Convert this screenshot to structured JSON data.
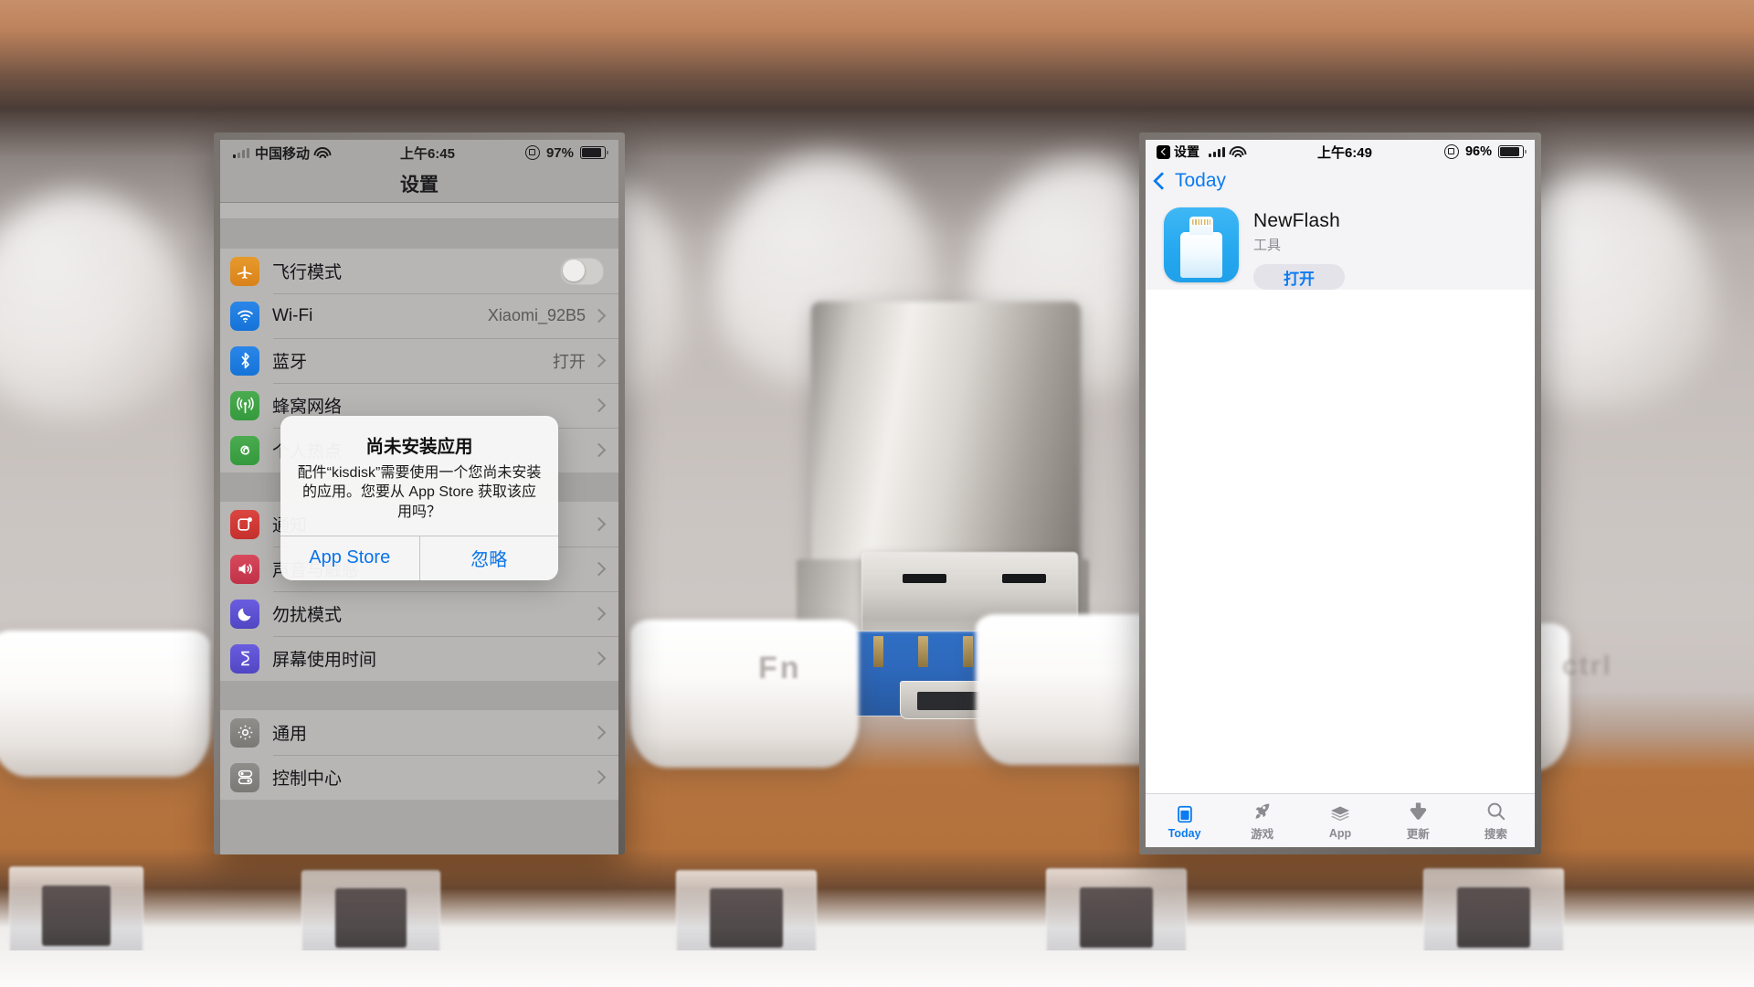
{
  "background": {
    "scene": "blurred mechanical keyboard with a USB flash drive standing between keycaps",
    "keycap_legends": [
      "Fn",
      "ctrl"
    ]
  },
  "left_phone": {
    "status_bar": {
      "carrier": "中国移动",
      "signal_icon": "cellular-bars-icon",
      "wifi_icon": "wifi-icon",
      "time": "上午6:45",
      "rotation_lock_icon": "rotation-lock-icon",
      "battery_percent": "97%",
      "battery_icon": "battery-icon"
    },
    "nav": {
      "title": "设置"
    },
    "rows": [
      {
        "icon": "airplane-icon",
        "glyph": "✈",
        "color": "#e08a1e",
        "label": "飞行模式",
        "control": "toggle",
        "value": "",
        "state": "off"
      },
      {
        "icon": "wifi-icon",
        "glyph": "",
        "color": "#1778e0",
        "label": "Wi-Fi",
        "control": "chevron",
        "value": "Xiaomi_92B5"
      },
      {
        "icon": "bluetooth-icon",
        "glyph": "",
        "color": "#1778e0",
        "label": "蓝牙",
        "control": "chevron",
        "value": "打开"
      },
      {
        "icon": "cellular-icon",
        "glyph": "",
        "color": "#3e9e47",
        "label": "蜂窝网络",
        "control": "chevron",
        "value": ""
      },
      {
        "icon": "hotspot-icon",
        "glyph": "",
        "color": "#3e9e47",
        "label": "个人热点",
        "control": "chevron",
        "value": ""
      },
      {
        "icon": "notifications-icon",
        "glyph": "",
        "color": "#cf3a35",
        "label": "通知",
        "control": "chevron",
        "value": ""
      },
      {
        "icon": "sound-icon",
        "glyph": "",
        "color": "#cc3f53",
        "label": "声音与触感",
        "control": "chevron",
        "value": ""
      },
      {
        "icon": "moon-icon",
        "glyph": "",
        "color": "#5b4fc4",
        "label": "勿扰模式",
        "control": "chevron",
        "value": ""
      },
      {
        "icon": "hourglass-icon",
        "glyph": "",
        "color": "#5b4fc4",
        "label": "屏幕使用时间",
        "control": "chevron",
        "value": ""
      },
      {
        "icon": "gear-icon",
        "glyph": "",
        "color": "#85847f",
        "label": "通用",
        "control": "chevron",
        "value": ""
      },
      {
        "icon": "control-center-icon",
        "glyph": "",
        "color": "#85847f",
        "label": "控制中心",
        "control": "chevron",
        "value": ""
      }
    ],
    "alert": {
      "title": "尚未安装应用",
      "message": "配件“kisdisk”需要使用一个您尚未安装的应用。您要从 App Store 获取该应用吗？",
      "primary_button": "App Store",
      "secondary_button": "忽略",
      "accent_color": "#0a74e8"
    }
  },
  "right_phone": {
    "status_bar": {
      "back_app": "设置",
      "signal_icon": "cellular-bars-icon",
      "wifi_icon": "wifi-icon",
      "time": "上午6:49",
      "rotation_lock_icon": "rotation-lock-icon",
      "battery_percent": "96%",
      "battery_icon": "battery-icon"
    },
    "nav": {
      "back_label": "Today"
    },
    "app": {
      "icon": "usb-flash-drive-icon",
      "name": "NewFlash",
      "category": "工具",
      "action_button": "打开"
    },
    "tabs": [
      {
        "label": "Today",
        "icon": "today-card-icon",
        "active": true
      },
      {
        "label": "游戏",
        "icon": "rocket-icon",
        "active": false
      },
      {
        "label": "App",
        "icon": "layers-icon",
        "active": false
      },
      {
        "label": "更新",
        "icon": "download-icon",
        "active": false
      },
      {
        "label": "搜索",
        "icon": "search-icon",
        "active": false
      }
    ],
    "accent_color": "#0b7bf0"
  }
}
